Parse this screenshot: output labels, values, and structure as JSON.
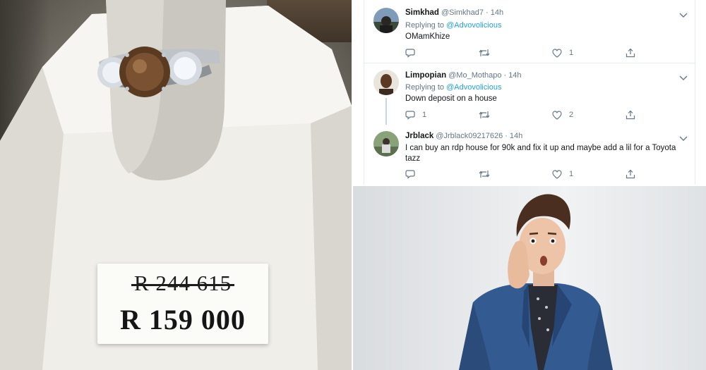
{
  "price_card": {
    "old_price": "R 244 615",
    "new_price": "R 159 000"
  },
  "tweets": [
    {
      "name": "Simkhad",
      "handle": "@Simkhad7",
      "time": "14h",
      "replying_prefix": "Replying to",
      "replying_to": "@Advovolicious",
      "text": "OMamKhize",
      "reply_count": "",
      "retweet_count": "",
      "like_count": "1"
    },
    {
      "name": "Limpopian",
      "handle": "@Mo_Mothapo",
      "time": "14h",
      "replying_prefix": "Replying to",
      "replying_to": "@Advovolicious",
      "text": "Down deposit on a house",
      "reply_count": "1",
      "retweet_count": "",
      "like_count": "2"
    },
    {
      "name": "Jrblack",
      "handle": "@Jrblack09217626",
      "time": "14h",
      "text": "I can buy an rdp house for 90k and fix it up and maybe add a lil for a Toyota tazz",
      "reply_count": "",
      "retweet_count": "",
      "like_count": "1"
    }
  ],
  "separator": "·",
  "icons": {
    "reply": "reply-icon",
    "retweet": "retweet-icon",
    "like": "heart-icon",
    "share": "share-icon",
    "menu": "chevron-down-icon"
  },
  "colors": {
    "link_blue": "#1da1f2",
    "secondary_text": "#657786",
    "primary_text": "#14171a",
    "divider": "#e6ecf0"
  }
}
